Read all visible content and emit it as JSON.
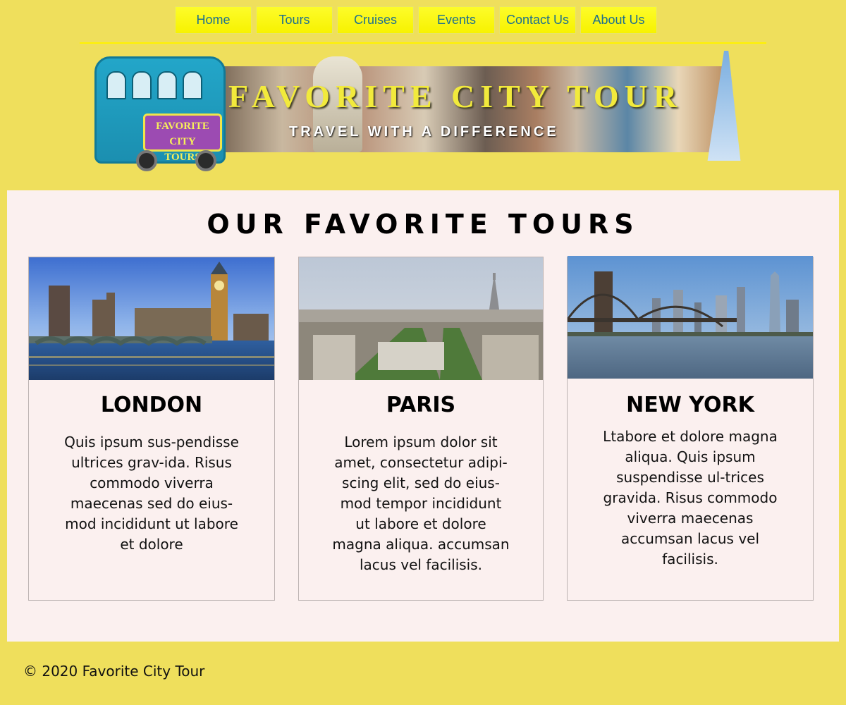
{
  "nav": {
    "items": [
      {
        "label": "Home"
      },
      {
        "label": "Tours"
      },
      {
        "label": "Cruises"
      },
      {
        "label": "Events"
      },
      {
        "label": "Contact Us"
      },
      {
        "label": "About Us"
      }
    ]
  },
  "banner": {
    "title": "FAVORITE CITY TOUR",
    "subtitle": "TRAVEL WITH A DIFFERENCE",
    "bus_logo_line1": "FAVORITE CITY",
    "bus_logo_line2": "TOURS"
  },
  "main": {
    "title": "OUR FAVORITE TOURS",
    "cards": [
      {
        "title": "LONDON",
        "text": "Quis ipsum sus-pendisse ultrices grav-ida. Risus commodo viverra maecenas sed do eius-mod incididunt ut labore et dolore"
      },
      {
        "title": "PARIS",
        "text": "Lorem ipsum dolor sit amet, consectetur adipi-scing elit, sed do eius-mod tempor incididunt ut labore et dolore magna aliqua. accumsan lacus vel facilisis."
      },
      {
        "title": "NEW YORK",
        "text": "Ltabore et dolore magna aliqua. Quis ipsum suspendisse ul-trices gravida. Risus commodo viverra maecenas accumsan lacus vel facilisis."
      }
    ]
  },
  "footer": {
    "copyright": "© 2020 Favorite City Tour"
  },
  "colors": {
    "page_bg": "#efdf5c",
    "nav_bg": "#fdfc2a",
    "nav_text": "#1d6f8f",
    "panel_bg": "#fbf0ef",
    "banner_title": "#f2ea3c"
  }
}
